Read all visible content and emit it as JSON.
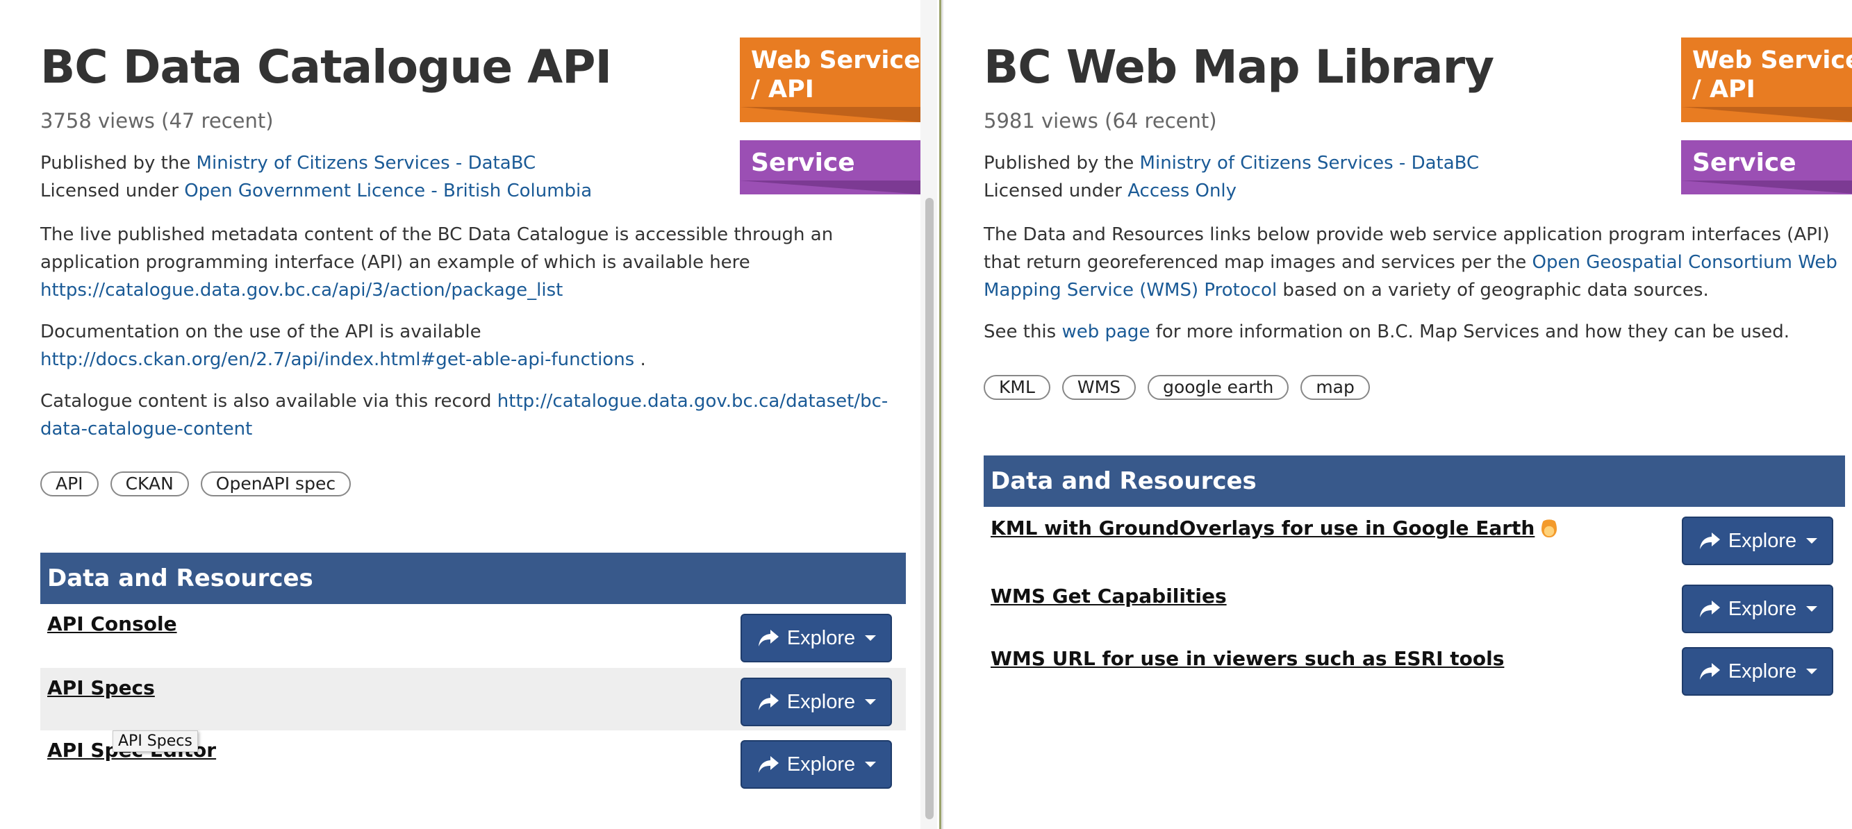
{
  "left": {
    "title": "BC Data Catalogue API",
    "views": "3758 views (47 recent)",
    "published_prefix": "Published by the",
    "publisher": "Ministry of Citizens Services - DataBC",
    "licensed_prefix": "Licensed under",
    "license": "Open Government Licence - British Columbia",
    "description_1": "The live published metadata content of the BC Data Catalogue is accessible through an application programming interface (API) an example of which is available here",
    "description_1_link": "https://catalogue.data.gov.bc.ca/api/3/action/package_list",
    "description_2": "Documentation on the use of the API is available",
    "description_2_link": "http://docs.ckan.org/en/2.7/api/index.html#get-able-api-functions",
    "description_2_end": " .",
    "description_3": "Catalogue content is also available via this record",
    "description_3_link": "http://catalogue.data.gov.bc.ca/dataset/bc-data-catalogue-content",
    "tags": [
      "API",
      "CKAN",
      "OpenAPI spec"
    ],
    "ribbon_type": "Web Service / API",
    "ribbon_type_line1": "Web Service",
    "ribbon_type_line2": "/ API",
    "ribbon_category": "Service",
    "resources_header": "Data and Resources",
    "resources": [
      {
        "name": "API Console",
        "button": "Explore"
      },
      {
        "name": "API Specs ",
        "button": "Explore"
      },
      {
        "name": "API Spec Editor",
        "button": "Explore"
      }
    ],
    "tooltip": "API Specs"
  },
  "right": {
    "title": "BC Web Map Library",
    "views": "5981 views (64 recent)",
    "published_prefix": "Published by the",
    "publisher": "Ministry of Citizens Services - DataBC",
    "licensed_prefix": "Licensed under",
    "license": "Access Only",
    "description_1a": "The Data and Resources links below provide web service application program interfaces (API) that return georeferenced map images and services per the",
    "description_1_link": "Open Geospatial Consortium Web Mapping Service (WMS) Protocol",
    "description_1b": " based on a variety of geographic data sources.",
    "description_2a": "See this",
    "description_2_link": "web page",
    "description_2b": " for more information on B.C. Map Services and how they can be used.",
    "tags": [
      "KML",
      "WMS",
      "google earth",
      "map"
    ],
    "ribbon_type_line1": "Web Service",
    "ribbon_type_line2": "/ API",
    "ribbon_category": "Service",
    "resources_header": "Data and Resources",
    "resources": [
      {
        "name": "KML with GroundOverlays for use in Google Earth",
        "button": "Explore"
      },
      {
        "name": "WMS Get Capabilities",
        "button": "Explore"
      },
      {
        "name": "WMS URL for use in viewers such as ESRI tools",
        "button": "Explore"
      }
    ]
  },
  "colors": {
    "accent_blue": "#38598b",
    "button_blue": "#2f528b",
    "link_blue": "#1a5a96",
    "ribbon_orange": "#e87c22",
    "ribbon_purple": "#9b4fb4"
  }
}
